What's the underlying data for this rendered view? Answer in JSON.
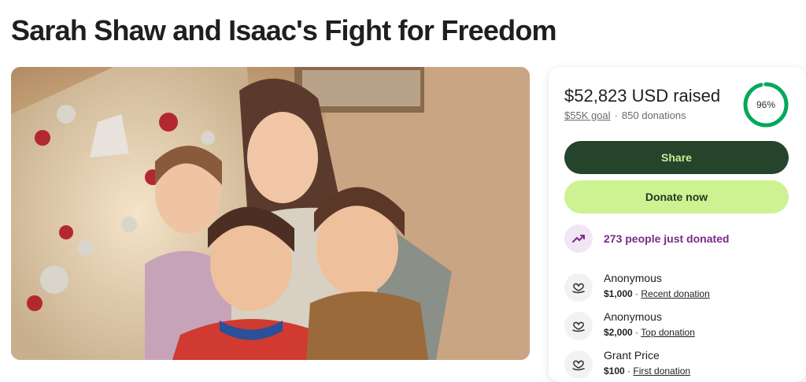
{
  "campaign": {
    "title": "Sarah Shaw and Isaac's Fight for Freedom",
    "photo_alt": "Family photo in front of a Christmas tree"
  },
  "progress": {
    "raised": "$52,823 USD raised",
    "goal": "$55K goal",
    "separator": "·",
    "donations": "850 donations",
    "percent_label": "96%",
    "percent": 0.96,
    "ring_color": "#02a95c"
  },
  "actions": {
    "share_label": "Share",
    "donate_label": "Donate now"
  },
  "trend": {
    "text": "273 people just donated",
    "icon": "trending-up-icon"
  },
  "donors": [
    {
      "name": "Anonymous",
      "amount": "$1,000",
      "sep": " · ",
      "tag": "Recent donation",
      "icon": "heart-hand-icon"
    },
    {
      "name": "Anonymous",
      "amount": "$2,000",
      "sep": " · ",
      "tag": "Top donation",
      "icon": "heart-hand-icon"
    },
    {
      "name": "Grant Price",
      "amount": "$100",
      "sep": " · ",
      "tag": "First donation",
      "icon": "heart-hand-icon"
    }
  ],
  "colors": {
    "share_bg": "#25442b",
    "donate_bg": "#cdf291",
    "trend_text": "#7a2a8a"
  }
}
